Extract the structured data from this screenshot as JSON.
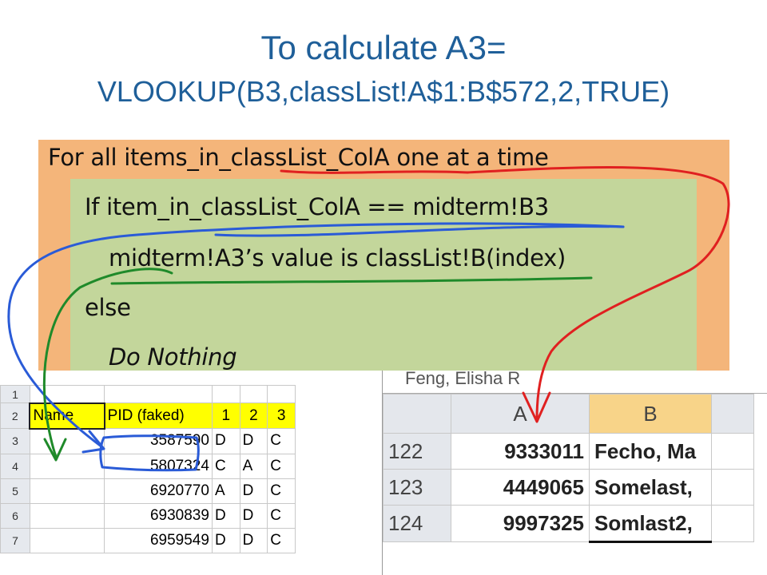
{
  "title": {
    "line1": "To calculate A3=",
    "line2": "VLOOKUP(B3,classList!A$1:B$572,2,TRUE)"
  },
  "pseudocode": {
    "line1": "For all items_in_classList_ColA one at a time",
    "line2": "If  item_in_classList_ColA == midterm!B3",
    "line3": "midterm!A3’s value is classList!B(index)",
    "line4": "else",
    "line5": "Do Nothing"
  },
  "left_sheet": {
    "header_row": {
      "row": "2",
      "cells": [
        "Name",
        "PID (faked)",
        "1",
        "2",
        "3"
      ]
    },
    "top_row_label": "1",
    "rows": [
      {
        "row": "3",
        "pid": "3587590",
        "c1": "D",
        "c2": "D",
        "c3": "C"
      },
      {
        "row": "4",
        "pid": "5807324",
        "c1": "C",
        "c2": "A",
        "c3": "C"
      },
      {
        "row": "5",
        "pid": "6920770",
        "c1": "A",
        "c2": "D",
        "c3": "C"
      },
      {
        "row": "6",
        "pid": "6930839",
        "c1": "D",
        "c2": "D",
        "c3": "C"
      },
      {
        "row": "7",
        "pid": "6959549",
        "c1": "D",
        "c2": "D",
        "c3": "C"
      }
    ]
  },
  "right_sheet": {
    "fragment_text": "Feng, Elisha R",
    "col_headers": [
      "A",
      "B"
    ],
    "rows": [
      {
        "row": "122",
        "a": "9333011",
        "b": "Fecho, Ma"
      },
      {
        "row": "123",
        "a": "4449065",
        "b": "Somelast,"
      },
      {
        "row": "124",
        "a": "9997325",
        "b": "Somlast2,"
      }
    ]
  },
  "annotation_colors": {
    "red": "#e02020",
    "blue": "#2a5bd7",
    "green": "#1f8a2a"
  }
}
